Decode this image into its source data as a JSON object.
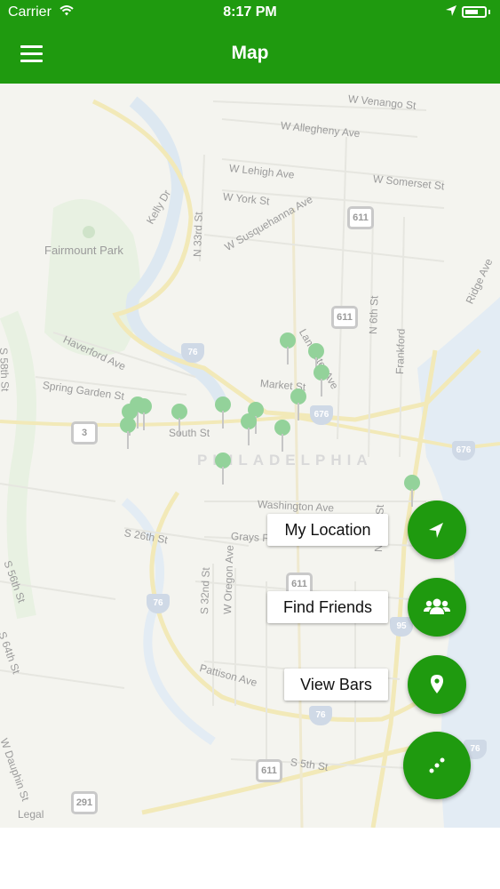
{
  "status_bar": {
    "carrier": "Carrier",
    "time": "8:17 PM",
    "wifi_icon": "wifi-icon",
    "location_icon": "location-arrow-icon",
    "battery_icon": "battery-icon"
  },
  "nav_bar": {
    "title": "Map",
    "menu_icon": "hamburger-menu-icon",
    "background": "#1f9a0f"
  },
  "map": {
    "legal": "Legal",
    "city": "PHILADELPHIA",
    "park": "Fairmount Park",
    "streets": [
      "W Venango St",
      "W Allegheny Ave",
      "W Lehigh Ave",
      "W Somerset St",
      "W York St",
      "Kelly Dr",
      "W Susquehanna Ave",
      "N 33rd St",
      "W Dauphin St",
      "N 10th St",
      "N 6th St",
      "Frankford",
      "Ridge Ave",
      "Lancaster Ave",
      "Haverford Ave",
      "Spring Garden St",
      "Market St",
      "South St",
      "Washington Ave",
      "Grays Ferry Ave",
      "S 26th St",
      "S 32nd St",
      "W Oregon Ave",
      "Pattison Ave",
      "S 5th St",
      "N 52nd St",
      "S 58th St",
      "S 56th St",
      "S 64th St"
    ],
    "highway_shields": [
      "611",
      "611",
      "611",
      "611",
      "3",
      "291"
    ],
    "interstate_shields": [
      "76",
      "676",
      "76",
      "676",
      "95",
      "76",
      "76"
    ],
    "marker_color": "#93d29a"
  },
  "actions": {
    "my_location": {
      "label": "My Location",
      "icon": "navigation-arrow-icon"
    },
    "find_friends": {
      "label": "Find Friends",
      "icon": "group-users-icon"
    },
    "view_bars": {
      "label": "View Bars",
      "icon": "map-pin-icon"
    },
    "toggle": {
      "icon": "dots-diagonal-icon"
    }
  }
}
